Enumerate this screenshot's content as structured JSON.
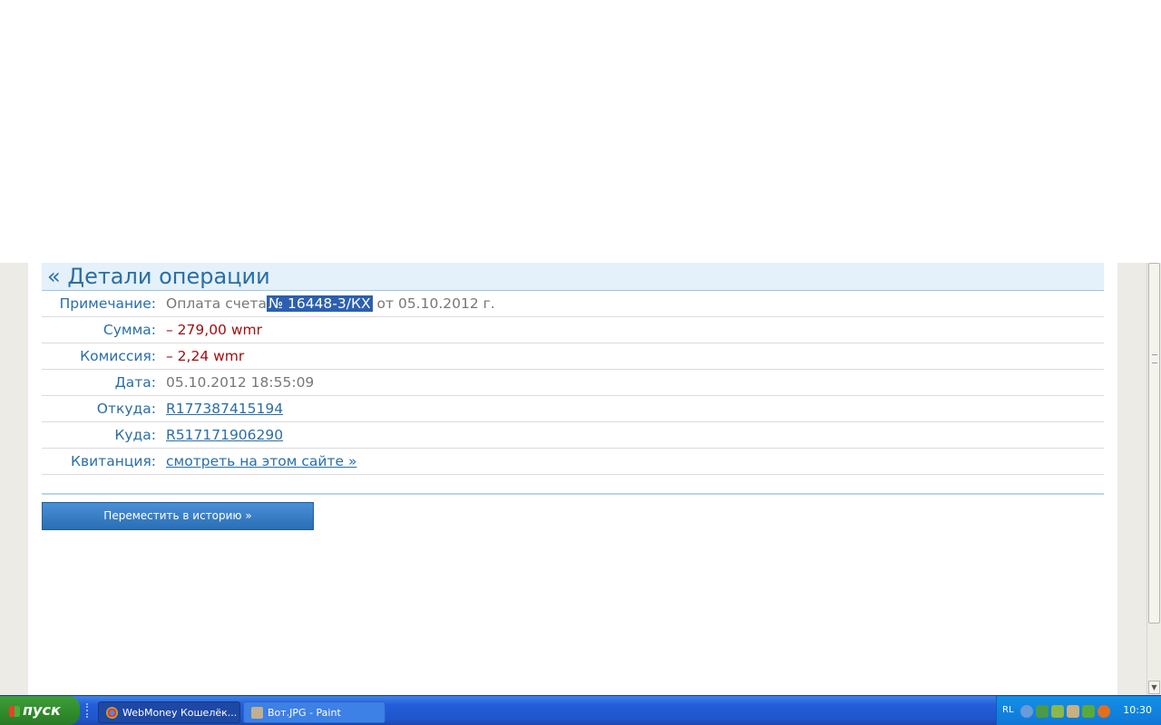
{
  "details": {
    "title": "« Детали операции",
    "rows": [
      {
        "label": "Примечание:",
        "value_pre": "Оплата счета",
        "value_highlight": "№ 16448-3/КХ",
        "value_post": " от 05.10.2012 г."
      },
      {
        "label": "Сумма:",
        "value": "– 279,00 wmr"
      },
      {
        "label": "Комиссия:",
        "value": "– 2,24 wmr"
      },
      {
        "label": "Дата:",
        "value": "05.10.2012 18:55:09"
      },
      {
        "label": "Откуда:",
        "value": "R177387415194"
      },
      {
        "label": "Куда:",
        "value": "R517171906290"
      },
      {
        "label": "Квитанция:",
        "value": "смотреть на этом сайте »"
      }
    ],
    "move_button": "Переместить в историю »"
  },
  "taskbar": {
    "start_label": "пуск",
    "tasks": [
      {
        "label": "WebMoney Кошелёк...",
        "icon": "chrome-icon",
        "active": true
      },
      {
        "label": "Вот.JPG - Paint",
        "icon": "paint-icon",
        "active": false
      }
    ],
    "language": "RL",
    "clock": "10:30"
  },
  "colors": {
    "accent": "#2a6ea6",
    "negative": "#a01010",
    "selection": "#2c5fb0",
    "taskbar": "#245edb"
  }
}
